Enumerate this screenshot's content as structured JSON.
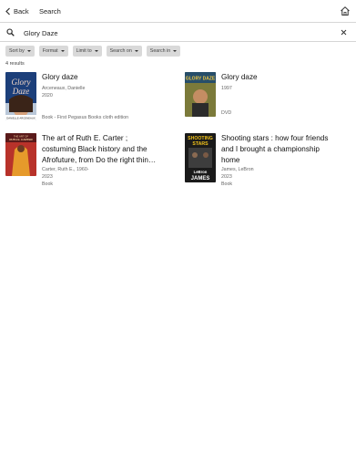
{
  "header": {
    "back_label": "Back",
    "title": "Search",
    "icons": {
      "back": "chevron-left-icon",
      "home": "home-icon"
    }
  },
  "search": {
    "value": "Glory Daze",
    "placeholder": "Search",
    "icons": {
      "search": "search-icon",
      "clear": "close-icon"
    }
  },
  "filters": [
    "Sort by",
    "Format",
    "Limit to",
    "Search on",
    "Search in"
  ],
  "results_count": "4 results",
  "results": [
    {
      "title": "Glory daze",
      "author": "Arceneaux, Danielle",
      "year": "2020",
      "format": "Book - First Pegasus Books cloth edition",
      "cover_text": [
        "Glory",
        "Daze",
        "DANIELLE ARCENEAUX"
      ]
    },
    {
      "title": "Glory daze",
      "author": "",
      "year": "1997",
      "format": "DVD",
      "cover_text": [
        "GLORY DAZE"
      ]
    },
    {
      "title_lines": [
        "The art of Ruth E. Carter ;",
        "costuming Black history and the",
        "Afrofuture, from Do the right thin…"
      ],
      "author": "Carter, Ruth E., 1960-",
      "year": "2023",
      "format": "Book",
      "cover_text": [
        "THE ART OF",
        "RUTH E. CARTER"
      ]
    },
    {
      "title_lines": [
        "Shooting stars : how four friends",
        "and I brought a championship",
        "home"
      ],
      "author": "James, LeBron",
      "year": "2023",
      "format": "Book",
      "cover_text": [
        "SHOOTING",
        "STARS",
        "LeBron",
        "JAMES"
      ]
    }
  ],
  "colors": {
    "divider": "#d6d6d6",
    "chip_bg": "#d9d9d9",
    "text_muted": "#666666"
  }
}
